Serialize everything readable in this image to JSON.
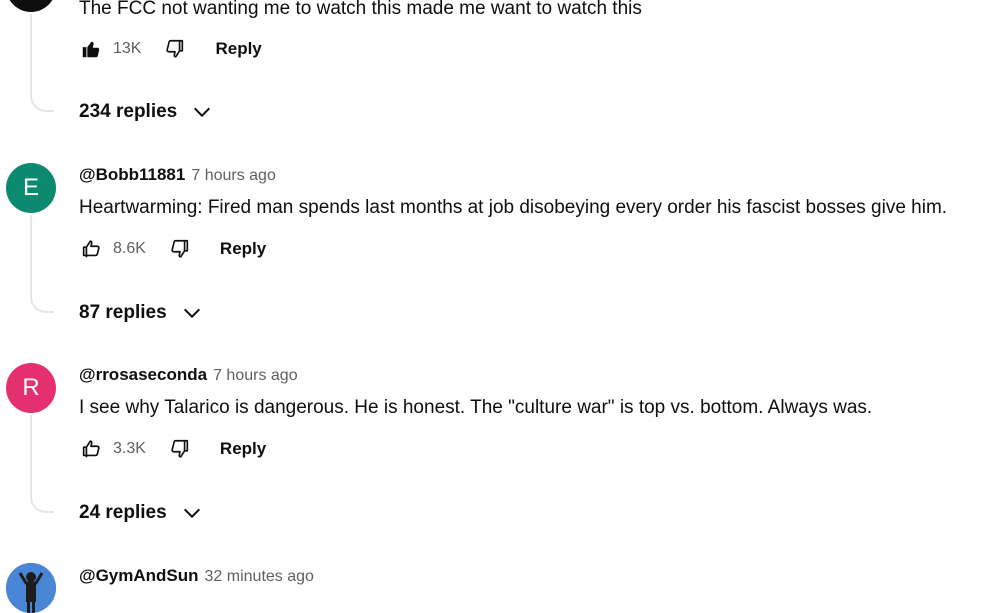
{
  "comments": [
    {
      "author": "",
      "time": "",
      "text": "The FCC not wanting me to watch this made me want to watch this",
      "likes": "13K",
      "liked": true,
      "reply_label": "Reply",
      "replies_label": "234 replies",
      "avatar_letter": "",
      "avatar_color": "#0f0f0f"
    },
    {
      "author": "@Bobb11881",
      "time": "7 hours ago",
      "text": "Heartwarming: Fired man spends last months at job disobeying every order his fascist bosses give him.",
      "likes": "8.6K",
      "liked": false,
      "reply_label": "Reply",
      "replies_label": "87 replies",
      "avatar_letter": "E",
      "avatar_color": "#0b8a6f"
    },
    {
      "author": "@rrosaseconda",
      "time": "7 hours ago",
      "text": "I see why Talarico is dangerous. He is honest. The \"culture war\" is top vs. bottom. Always was.",
      "likes": "3.3K",
      "liked": false,
      "reply_label": "Reply",
      "replies_label": "24 replies",
      "avatar_letter": "R",
      "avatar_color": "#e5306f"
    },
    {
      "author": "@GymAndSun",
      "time": "32 minutes ago",
      "avatar_color": "#3f7fd1"
    }
  ]
}
